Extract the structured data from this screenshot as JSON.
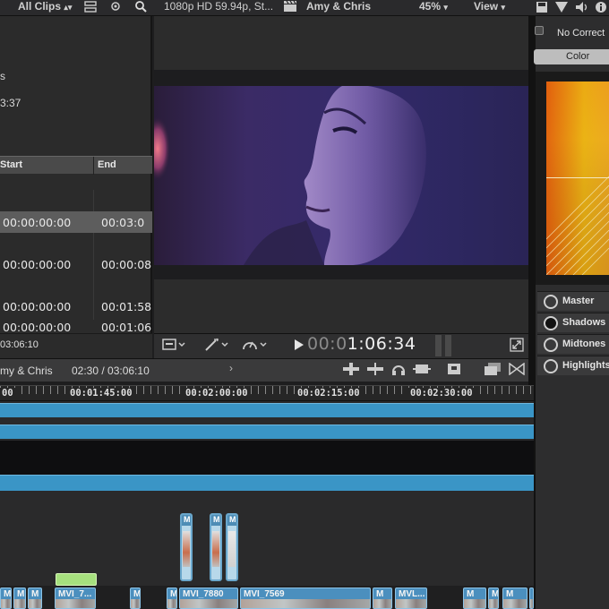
{
  "topbar": {
    "clips_filter": "All Clips",
    "format": "1080p HD 59.94p, St...",
    "project": "Amy & Chris",
    "zoom": "45%",
    "view": "View"
  },
  "browser": {
    "meta_line1": "s",
    "meta_line2": "3:37",
    "columns": {
      "start": "Start",
      "end": "End"
    },
    "rows": [
      {
        "start": "00:00:00:00",
        "end": "00:03:0"
      },
      {
        "start": "00:00:00:00",
        "end": "00:00:08"
      },
      {
        "start": "00:00:00:00",
        "end": "00:01:58"
      },
      {
        "start": "00:00:00:00",
        "end": "00:01:06"
      }
    ],
    "footer_duration": "03:06:10"
  },
  "viewer": {
    "timecode_dim": "00:0",
    "timecode_main": "1:06:34"
  },
  "inspector": {
    "no_correction": "No Correct",
    "tab": "Color",
    "pucks": [
      "Master",
      "Shadows",
      "Midtones",
      "Highlights"
    ]
  },
  "timeline": {
    "project": "my & Chris",
    "position": "02:30 / 03:06:10",
    "ruler_labels": [
      "00",
      "00:01:45:00",
      "00:02:00:00",
      "00:02:15:00",
      "00:02:30:00"
    ],
    "connected_clips": [
      "M",
      "M",
      "M"
    ],
    "strip_clips": [
      "M",
      "M",
      "M",
      "MVI_7...",
      "M",
      "M",
      "MVI_7880",
      "MVI_7569",
      "M",
      "MVL...",
      "M",
      "M",
      "M",
      "M"
    ]
  }
}
